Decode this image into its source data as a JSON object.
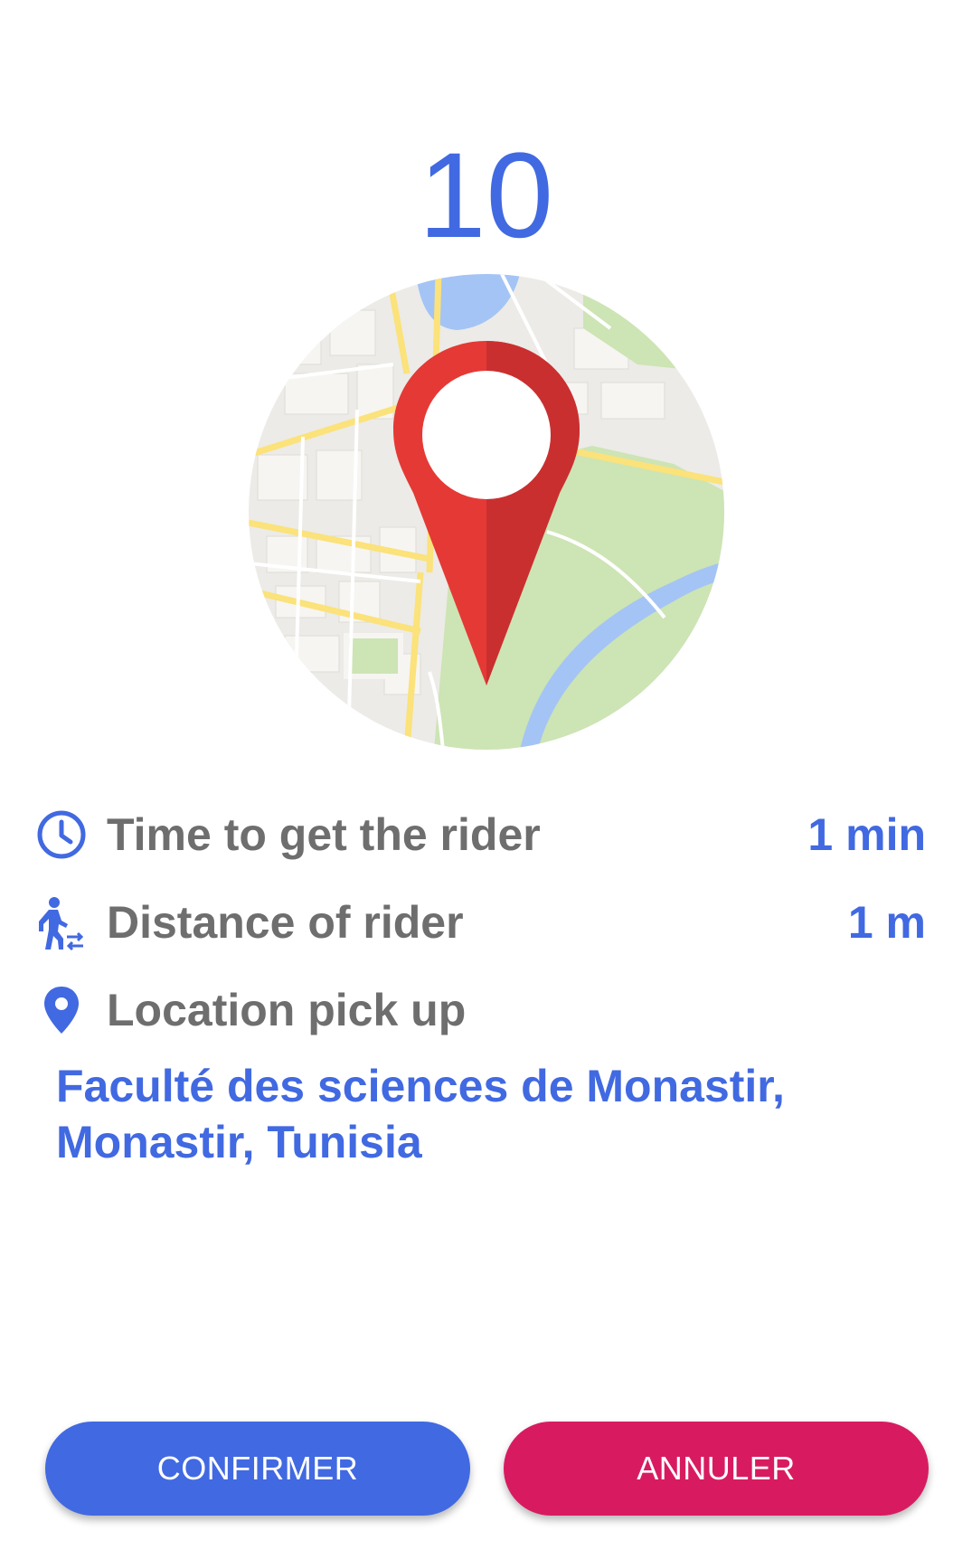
{
  "countdown": "10",
  "map": {
    "icon": "map-pin-illustration",
    "pin_color": "#e53935",
    "road_color": "#fbe27a",
    "park_color": "#cde4b4",
    "water_color": "#a4c4f5"
  },
  "info": {
    "time": {
      "icon": "clock-icon",
      "label": "Time to get the rider",
      "value": "1 min"
    },
    "distance": {
      "icon": "walking-person-icon",
      "label": "Distance of rider",
      "value": "1 m"
    },
    "location": {
      "icon": "location-pin-icon",
      "label": "Location pick up"
    }
  },
  "address": {
    "line1": "Faculté des sciences de Monastir,",
    "line2": "Monastir, Tunisia"
  },
  "buttons": {
    "confirm_label": "CONFIRMER",
    "cancel_label": "ANNULER"
  },
  "colors": {
    "accent": "#4169e1",
    "danger": "#d81b60",
    "label_gray": "#6e6e6e"
  }
}
